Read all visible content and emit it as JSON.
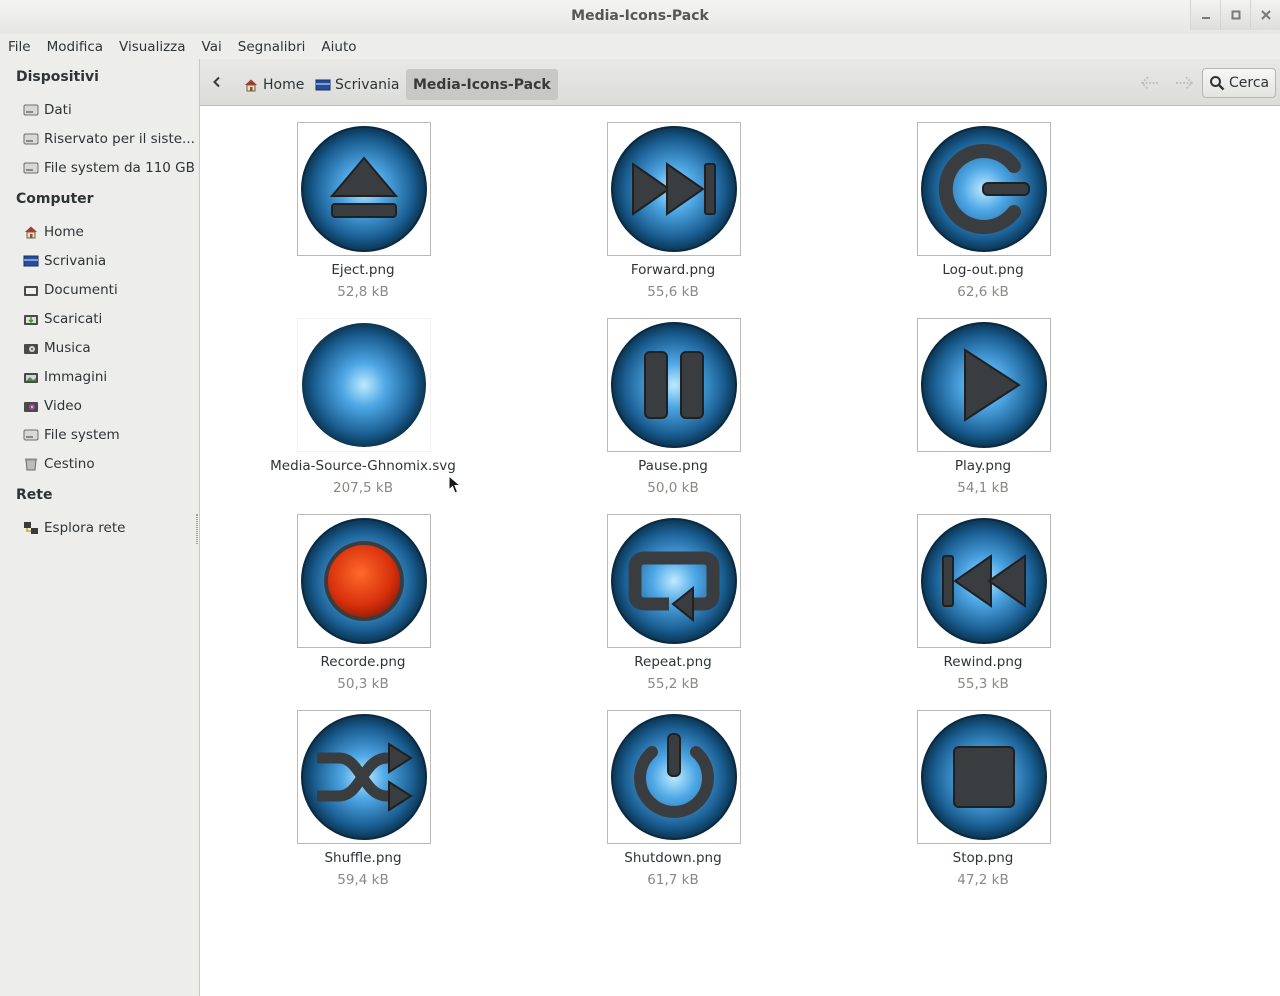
{
  "window": {
    "title": "Media-Icons-Pack"
  },
  "menubar": {
    "items": [
      "File",
      "Modifica",
      "Visualizza",
      "Vai",
      "Segnalibri",
      "Aiuto"
    ]
  },
  "sidebar": {
    "sections": [
      {
        "title": "Dispositivi",
        "items": [
          {
            "label": "Dati",
            "icon": "drive-icon"
          },
          {
            "label": "Riservato per il siste...",
            "icon": "drive-icon"
          },
          {
            "label": "File system da 110 GB",
            "icon": "drive-icon"
          }
        ]
      },
      {
        "title": "Computer",
        "items": [
          {
            "label": "Home",
            "icon": "home-icon"
          },
          {
            "label": "Scrivania",
            "icon": "desktop-icon"
          },
          {
            "label": "Documenti",
            "icon": "documents-folder-icon"
          },
          {
            "label": "Scaricati",
            "icon": "downloads-folder-icon"
          },
          {
            "label": "Musica",
            "icon": "music-folder-icon"
          },
          {
            "label": "Immagini",
            "icon": "pictures-folder-icon"
          },
          {
            "label": "Video",
            "icon": "videos-folder-icon"
          },
          {
            "label": "File system",
            "icon": "drive-icon"
          },
          {
            "label": "Cestino",
            "icon": "trash-icon"
          }
        ]
      },
      {
        "title": "Rete",
        "items": [
          {
            "label": "Esplora rete",
            "icon": "network-icon"
          }
        ]
      }
    ]
  },
  "toolbar": {
    "breadcrumbs": [
      "Home",
      "Scrivania",
      "Media-Icons-Pack"
    ],
    "search_label": "Cerca"
  },
  "files": [
    {
      "name": "Eject.png",
      "size": "52,8 kB",
      "glyph": "eject"
    },
    {
      "name": "Forward.png",
      "size": "55,6 kB",
      "glyph": "forward"
    },
    {
      "name": "Log-out.png",
      "size": "62,6 kB",
      "glyph": "logout"
    },
    {
      "name": "Media-Source-Ghnomix.svg",
      "size": "207,5 kB",
      "glyph": "source"
    },
    {
      "name": "Pause.png",
      "size": "50,0 kB",
      "glyph": "pause"
    },
    {
      "name": "Play.png",
      "size": "54,1 kB",
      "glyph": "play"
    },
    {
      "name": "Recorde.png",
      "size": "50,3 kB",
      "glyph": "record"
    },
    {
      "name": "Repeat.png",
      "size": "55,2 kB",
      "glyph": "repeat"
    },
    {
      "name": "Rewind.png",
      "size": "55,3 kB",
      "glyph": "rewind"
    },
    {
      "name": "Shuffle.png",
      "size": "59,4 kB",
      "glyph": "shuffle"
    },
    {
      "name": "Shutdown.png",
      "size": "61,7 kB",
      "glyph": "shutdown"
    },
    {
      "name": "Stop.png",
      "size": "47,2 kB",
      "glyph": "stop"
    }
  ],
  "colors": {
    "orb_light": "#7fd0ff",
    "orb_dark": "#0b3552",
    "glyph": "#3a3d40",
    "record_red": "#e23a10"
  }
}
